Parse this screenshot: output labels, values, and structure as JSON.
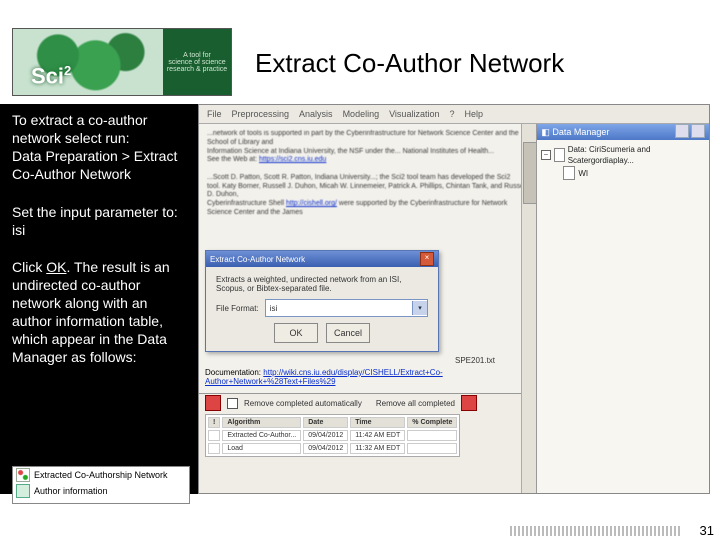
{
  "logo": {
    "brand_prefix": "Sci",
    "brand_sup": "2",
    "side_line1": "A tool for",
    "side_line2": "science of science",
    "side_line3": "research & practice"
  },
  "title": "Extract Co-Author Network",
  "sidebar": {
    "p1": "To extract a co-author network select run: ",
    "path": "Data Preparation > Extract Co-Author Network",
    "p2a": "Set the input parameter to: ",
    "p2b": "isi",
    "p3a": "Click ",
    "p3b": "OK",
    "p3c": ". The result is an undirected  co-author network along with an author information table, which appear in the Data Manager as follows:"
  },
  "result": {
    "row1": "Extracted Co-Authorship Network",
    "row2": "Author information"
  },
  "app": {
    "menus": [
      "File",
      "Preprocessing",
      "Analysis",
      "Modeling",
      "Visualization",
      "?",
      "Help"
    ],
    "console": {
      "l1": "...network of tools is supported in part by the Cyberinfrastructure for Network Science Center and the School of Library and",
      "l2": "Information Science at Indiana University, the NSF under the... National Institutes of Health...",
      "l3": "See the Web at: ",
      "url1": "https://sci2.cns.iu.edu",
      "l4": "",
      "l5": "...Scott D. Patton, Scott R. Patton, Indiana University...; the Sci2 tool team has developed the Sci2",
      "l6": "tool. Katy Borner, Russell J. Duhon, Micah W. Linnemeier, Patrick A. Phillips, Chintan Tank, and Russell D. Duhon,",
      "l7": "Cyberinfrastructure Shell ",
      "url2": "http://cishell.org/",
      "l8": "were supported by the Cyberinfrastructure for Network Science Center and the James",
      "file": "SPE201.txt",
      "doc_label": "Documentation:",
      "doc_url": "http://wiki.cns.iu.edu/display/CISHELL/Extract+Co-Author+Network+%28Text+Files%29"
    },
    "dialog": {
      "title": "Extract Co-Author Network",
      "desc": "Extracts a weighted, undirected network from an ISI, Scopus, or Bibtex-separated file.",
      "label": "File Format:",
      "value": "isi",
      "ok": "OK",
      "cancel": "Cancel"
    },
    "scheduler": {
      "chk1": "Remove completed automatically",
      "chk2": "Remove all completed",
      "cols": [
        "!",
        "Algorithm",
        "Date",
        "Time",
        "% Complete"
      ],
      "rows": [
        [
          "",
          "Extracted Co-Author...",
          "09/04/2012",
          "11:42 AM EDT",
          ""
        ],
        [
          "",
          "Load",
          "09/04/2012",
          "11:32 AM EDT",
          ""
        ]
      ]
    },
    "dm": {
      "title": "Data Manager",
      "root": "Data: CiriScumeria and Scatergordiaplay...",
      "child": "WI"
    }
  },
  "page_number": "31"
}
